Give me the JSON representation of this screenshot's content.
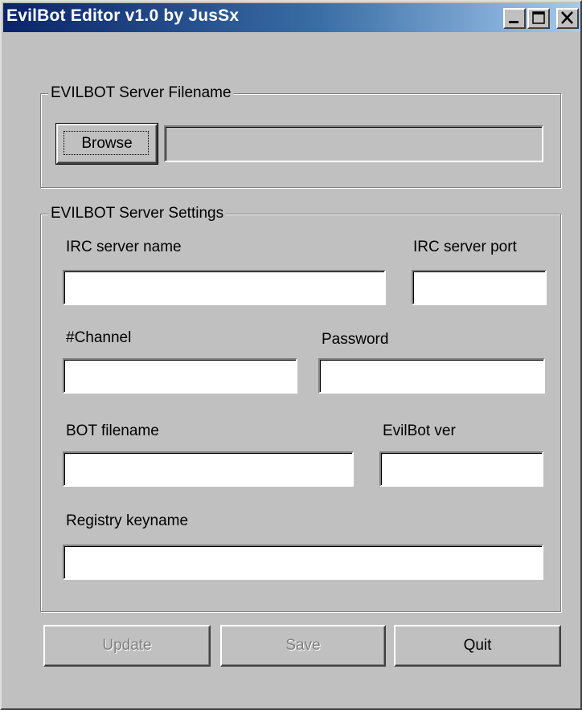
{
  "window": {
    "title": "EvilBot Editor v1.0  by JusSx",
    "controls": [
      "minimize-icon",
      "maximize-icon",
      "close-icon"
    ]
  },
  "filename_group": {
    "legend": "EVILBOT Server Filename",
    "browse_label": "Browse",
    "path_value": ""
  },
  "settings_group": {
    "legend": "EVILBOT Server Settings",
    "irc_server_name": {
      "label": "IRC server name",
      "value": ""
    },
    "irc_server_port": {
      "label": "IRC server port",
      "value": ""
    },
    "channel": {
      "label": "#Channel",
      "value": ""
    },
    "password": {
      "label": "Password",
      "value": ""
    },
    "bot_filename": {
      "label": "BOT filename",
      "value": ""
    },
    "evilbot_ver": {
      "label": "EvilBot ver",
      "value": ""
    },
    "registry_keyname": {
      "label": "Registry keyname",
      "value": ""
    }
  },
  "buttons": {
    "update": "Update",
    "save": "Save",
    "quit": "Quit"
  }
}
